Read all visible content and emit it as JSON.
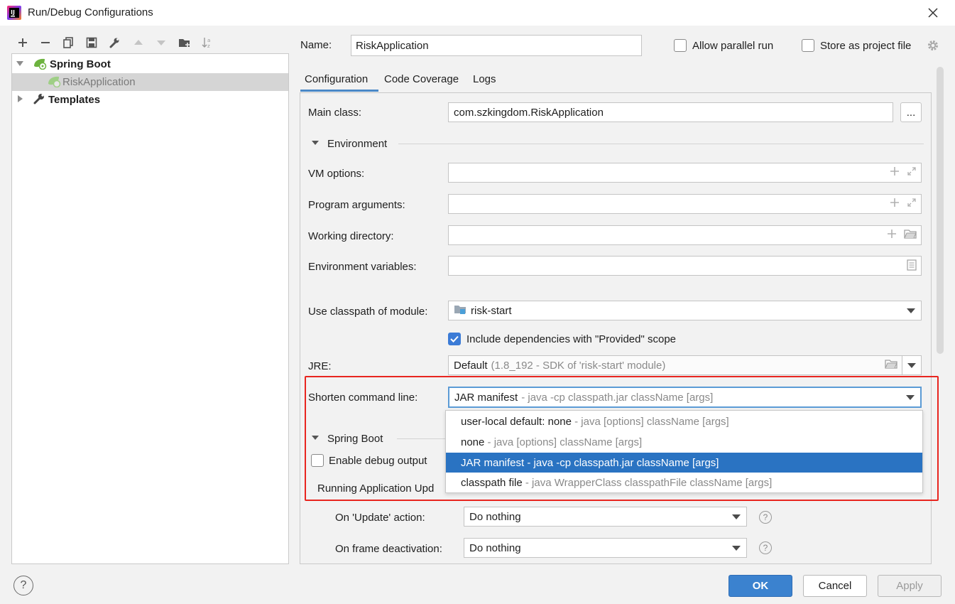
{
  "window": {
    "title": "Run/Debug Configurations"
  },
  "toolbar": {
    "icons": [
      "add-icon",
      "remove-icon",
      "copy-icon",
      "save-icon",
      "wrench-icon",
      "move-up-icon",
      "move-down-icon",
      "new-folder-icon",
      "sort-icon"
    ]
  },
  "tree": {
    "items": [
      {
        "label": "Spring Boot",
        "bold": true,
        "expanded": true
      },
      {
        "label": "RiskApplication",
        "selected": true
      },
      {
        "label": "Templates",
        "bold": true,
        "expanded": false
      }
    ]
  },
  "header": {
    "name_label": "Name:",
    "name_value": "RiskApplication",
    "allow_parallel_label": "Allow parallel run",
    "store_project_label": "Store as project file"
  },
  "tabs": [
    {
      "label": "Configuration",
      "active": true
    },
    {
      "label": "Code Coverage"
    },
    {
      "label": "Logs"
    }
  ],
  "config": {
    "main_class_label": "Main class:",
    "main_class_value": "com.szkingdom.RiskApplication",
    "browse_label": "...",
    "environment_section": "Environment",
    "vm_options_label": "VM options:",
    "program_args_label": "Program arguments:",
    "working_dir_label": "Working directory:",
    "env_vars_label": "Environment variables:",
    "classpath_label": "Use classpath of module:",
    "classpath_value": "risk-start",
    "include_deps_label": "Include dependencies with \"Provided\" scope",
    "jre_label": "JRE:",
    "jre_value": "Default",
    "jre_hint": "(1.8_192 - SDK of 'risk-start' module)",
    "shorten_label": "Shorten command line:",
    "shorten_value": "JAR manifest",
    "shorten_hint": "- java -cp classpath.jar className [args]",
    "spring_boot_section": "Spring Boot",
    "enable_debug_label": "Enable debug output",
    "running_app_label": "Running Application Upd",
    "on_update_label": "On 'Update' action:",
    "on_update_value": "Do nothing",
    "on_frame_label": "On frame deactivation:",
    "on_frame_value": "Do nothing"
  },
  "shorten_options": [
    {
      "name": "user-local default: none",
      "hint": "- java [options] className [args]"
    },
    {
      "name": "none",
      "hint": "- java [options] className [args]"
    },
    {
      "name": "JAR manifest",
      "hint": "- java -cp classpath.jar className [args]",
      "selected": true
    },
    {
      "name": "classpath file",
      "hint": "- java WrapperClass classpathFile className [args]"
    }
  ],
  "buttons": {
    "ok": "OK",
    "cancel": "Cancel",
    "apply": "Apply",
    "help": "?"
  },
  "colors": {
    "accent": "#3b82cf",
    "selection": "#2a73c2",
    "highlight_border": "#e8251f"
  }
}
